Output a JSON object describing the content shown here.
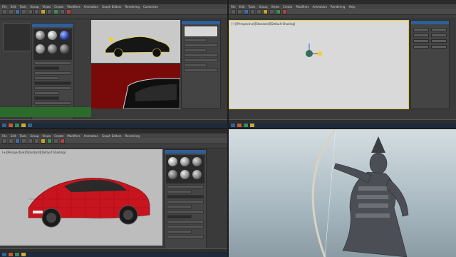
{
  "quadrants": {
    "top_left": {
      "window_title": "",
      "menu": [
        "File",
        "Edit",
        "Tools",
        "Group",
        "Views",
        "Create",
        "Modifiers",
        "Animation",
        "Graph Editors",
        "Rendering",
        "Customize",
        "Scripting",
        "Help"
      ],
      "viewport_label": "[+][Perspective][Realistic]",
      "material_editor_title": "Material Editor",
      "car_color": "#1a1a1a",
      "render_bg": "#7a0a0a"
    },
    "top_right": {
      "window_title": "",
      "menu": [
        "File",
        "Edit",
        "Tools",
        "Group",
        "Views",
        "Create",
        "Modifiers",
        "Animation",
        "Rendering",
        "Help"
      ],
      "viewport_label": "[+][Perspective][Standard][Default Shading]"
    },
    "bottom_left": {
      "window_title": "",
      "menu": [
        "File",
        "Edit",
        "Tools",
        "Group",
        "Views",
        "Create",
        "Modifiers",
        "Animation",
        "Graph Editors",
        "Rendering",
        "Help"
      ],
      "viewport_label": "[+][Perspective][Standard][Default Shading]",
      "car_color": "#c8141e",
      "material_editor_title": "Material Editor"
    },
    "bottom_right": {
      "bg_top": "#cfd8dc",
      "bg_bottom": "#8fa1ab"
    }
  },
  "icons": [
    "gizmo-icon",
    "sphere-slot-icon",
    "windows-start-icon"
  ],
  "colors": {
    "ui_dark": "#3a3a3a",
    "accent_blue": "#2f5f9a",
    "gizmo_yellow": "#f2d022"
  }
}
